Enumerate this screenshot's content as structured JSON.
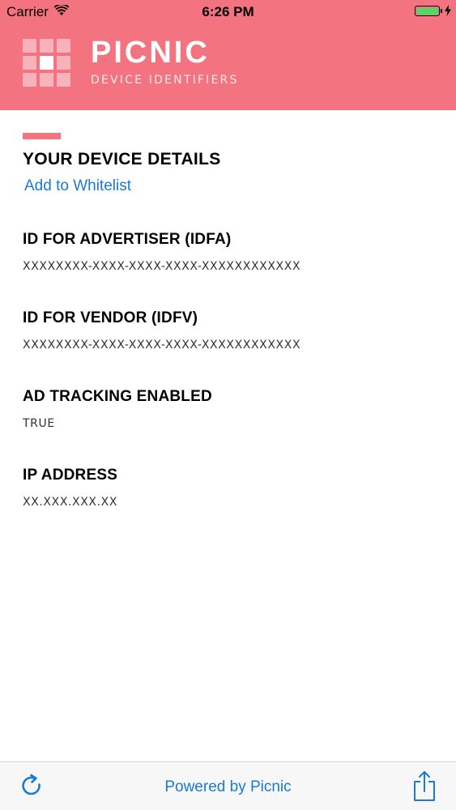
{
  "status_bar": {
    "carrier": "Carrier",
    "time": "6:26 PM",
    "battery_color": "#4cd964"
  },
  "header": {
    "title": "PICNIC",
    "subtitle": "DEVICE IDENTIFIERS",
    "background": "#f37480",
    "logo_icon": "grid-logo-icon"
  },
  "main": {
    "section_title": "YOUR DEVICE DETAILS",
    "whitelist_link": "Add to Whitelist",
    "fields": [
      {
        "label": "ID FOR ADVERTISER (IDFA)",
        "value": "XXXXXXXX-XXXX-XXXX-XXXX-XXXXXXXXXXXX"
      },
      {
        "label": "ID FOR VENDOR (IDFV)",
        "value": "XXXXXXXX-XXXX-XXXX-XXXX-XXXXXXXXXXXX"
      },
      {
        "label": "AD TRACKING ENABLED",
        "value": "TRUE"
      },
      {
        "label": "IP ADDRESS",
        "value": "XX.XXX.XXX.XX"
      }
    ]
  },
  "toolbar": {
    "refresh_icon": "refresh-icon",
    "powered_by": "Powered by Picnic",
    "share_icon": "share-icon",
    "link_color": "#1a7ad4"
  }
}
